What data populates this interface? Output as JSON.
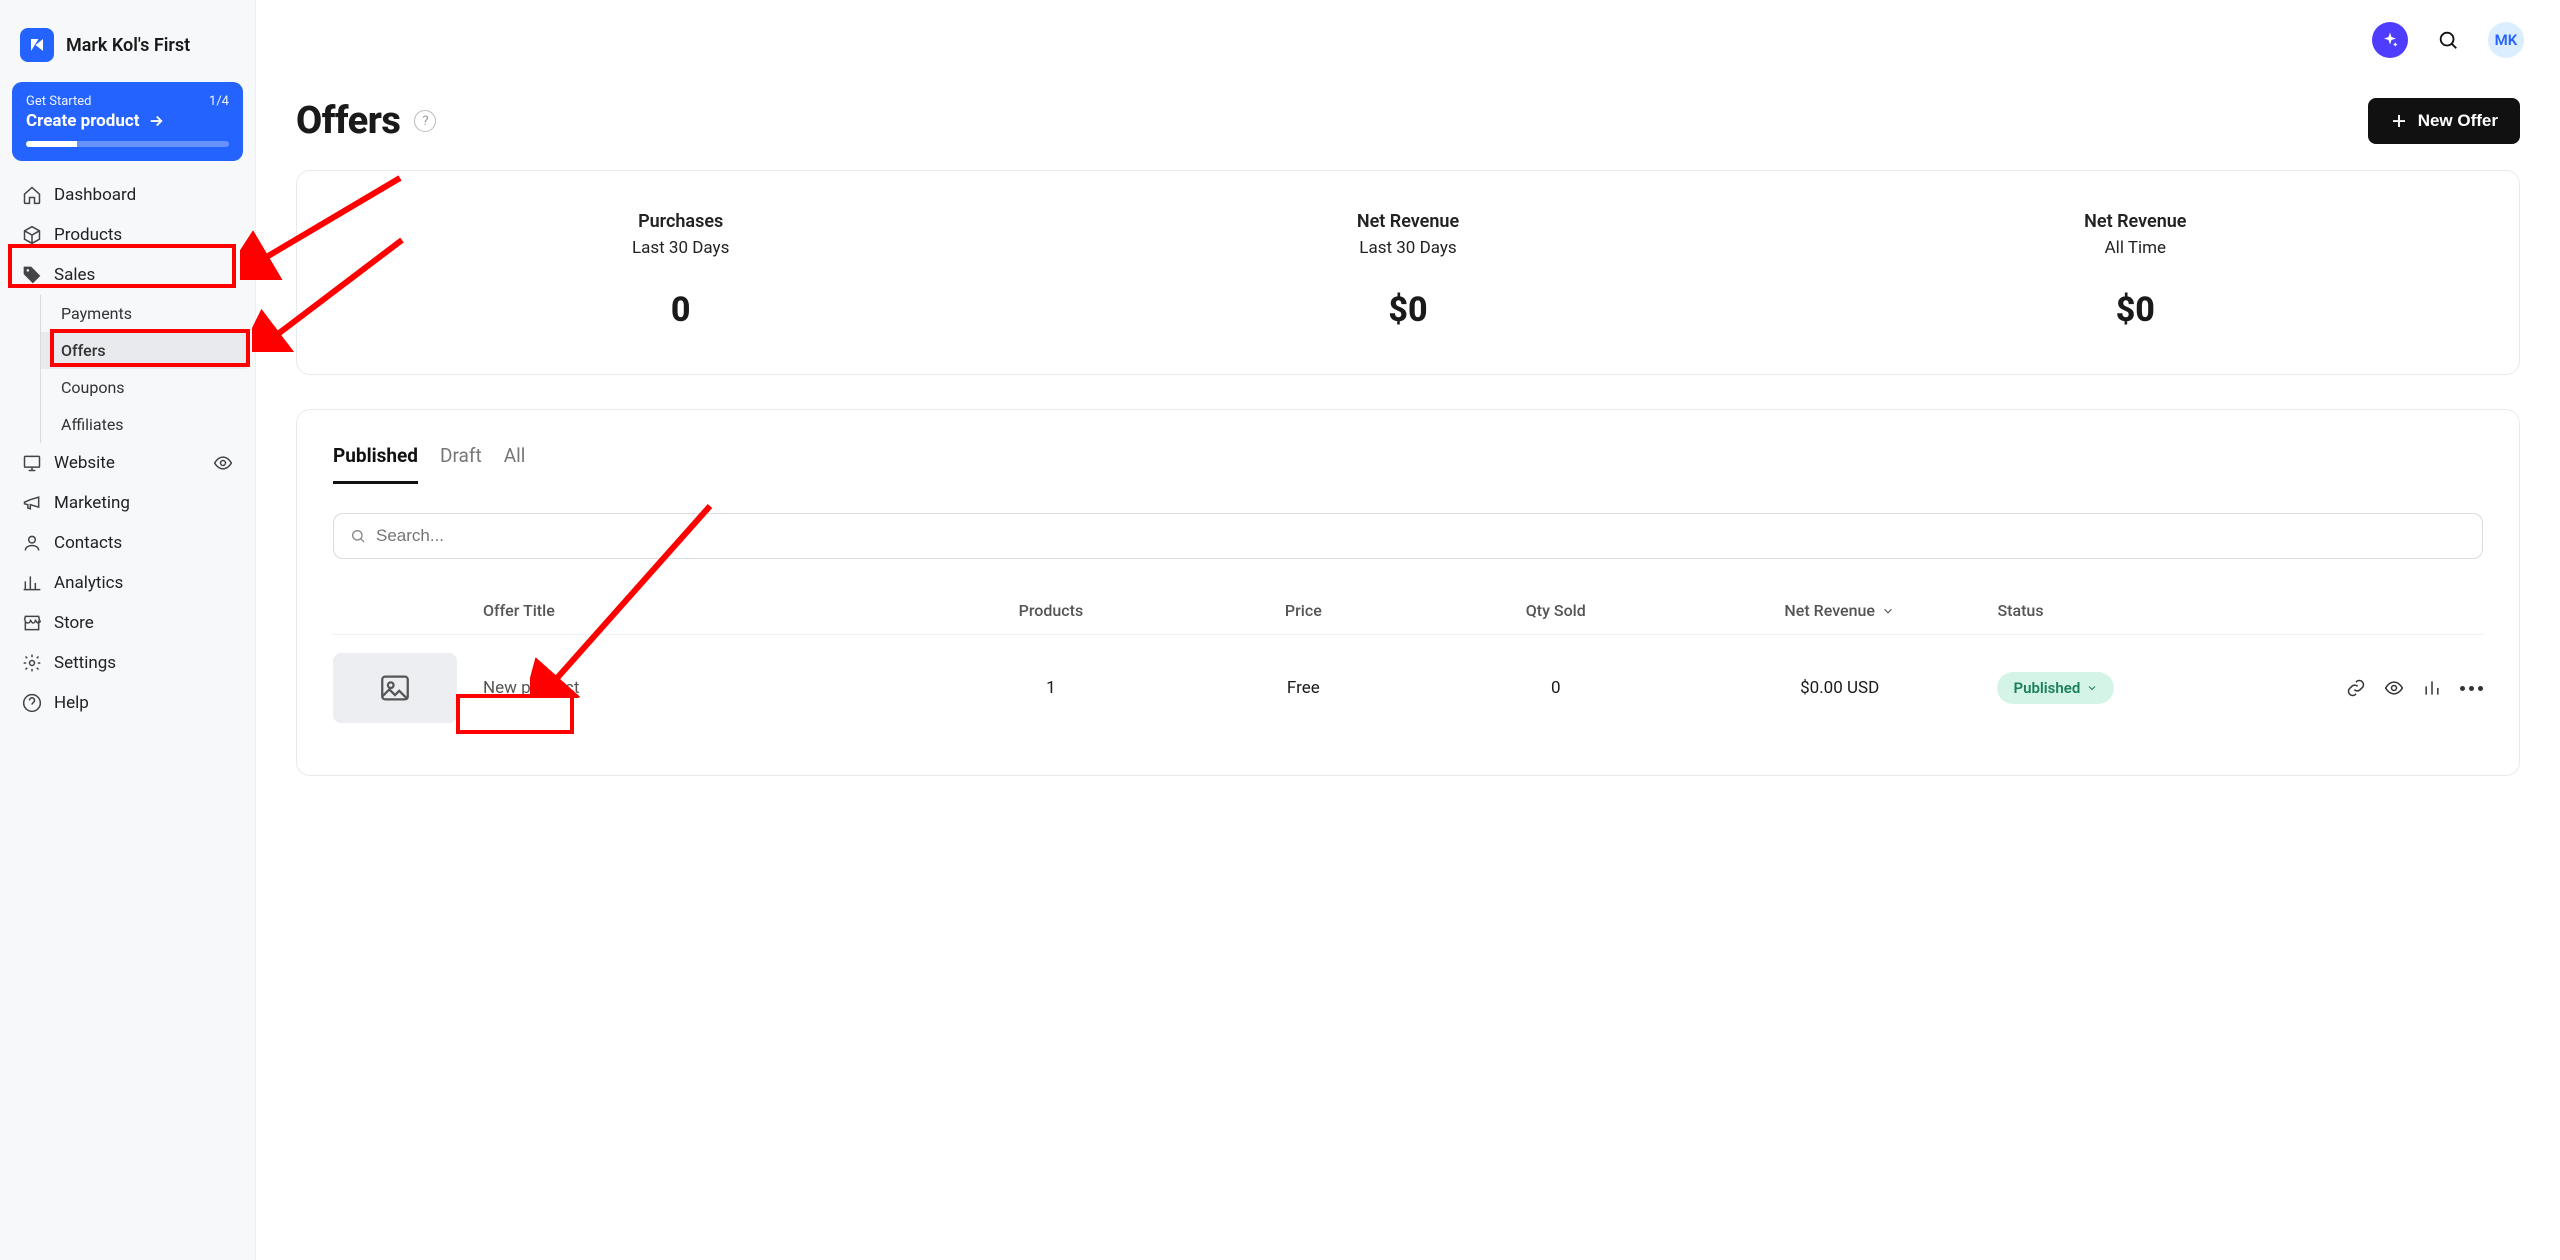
{
  "brand": {
    "name": "Mark Kol's First"
  },
  "getStarted": {
    "label": "Get Started",
    "progress": "1/4",
    "action": "Create product"
  },
  "nav": {
    "dashboard": "Dashboard",
    "products": "Products",
    "sales": "Sales",
    "salesSub": {
      "payments": "Payments",
      "offers": "Offers",
      "coupons": "Coupons",
      "affiliates": "Affiliates"
    },
    "website": "Website",
    "marketing": "Marketing",
    "contacts": "Contacts",
    "analytics": "Analytics",
    "store": "Store",
    "settings": "Settings",
    "help": "Help"
  },
  "avatar": "MK",
  "page": {
    "title": "Offers",
    "newOffer": "+ New Offer",
    "newOfferLabel": "New Offer"
  },
  "stats": [
    {
      "label": "Purchases",
      "sub": "Last 30 Days",
      "value": "0"
    },
    {
      "label": "Net Revenue",
      "sub": "Last 30 Days",
      "value": "$0"
    },
    {
      "label": "Net Revenue",
      "sub": "All Time",
      "value": "$0"
    }
  ],
  "tabs": {
    "published": "Published",
    "draft": "Draft",
    "all": "All"
  },
  "search": {
    "placeholder": "Search..."
  },
  "table": {
    "headers": {
      "title": "Offer Title",
      "products": "Products",
      "price": "Price",
      "qty": "Qty Sold",
      "rev": "Net Revenue",
      "status": "Status"
    },
    "rows": [
      {
        "title": "New product",
        "products": "1",
        "price": "Free",
        "qty": "0",
        "rev": "$0.00 USD",
        "status": "Published"
      }
    ]
  }
}
